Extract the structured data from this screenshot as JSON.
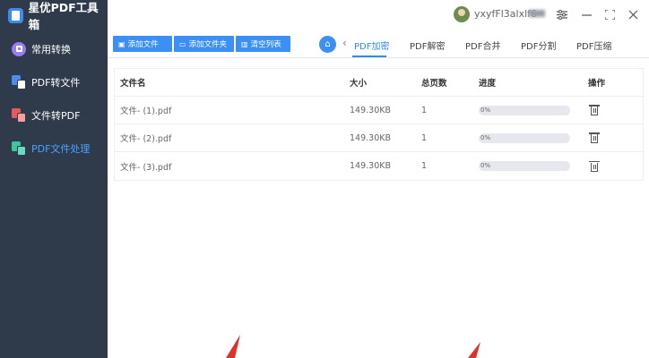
{
  "app": {
    "title": "星优PDF工具箱"
  },
  "sidebar": {
    "items": [
      {
        "label": "常用转换",
        "icon": "common-convert-icon"
      },
      {
        "label": "PDF转文件",
        "icon": "pdf-to-file-icon"
      },
      {
        "label": "文件转PDF",
        "icon": "file-to-pdf-icon"
      },
      {
        "label": "PDF文件处理",
        "icon": "pdf-process-icon",
        "active": true
      }
    ]
  },
  "titlebar": {
    "username": "yxyfFl3alxlf6",
    "settings_icon": "sliders-icon",
    "minimize_icon": "minimize-icon",
    "maximize_icon": "maximize-icon",
    "close_icon": "close-icon"
  },
  "toolbar": {
    "add_file": "添加文件",
    "add_folder": "添加文件夹",
    "clear_list": "清空列表"
  },
  "tabs": [
    "PDF加密",
    "PDF解密",
    "PDF合并",
    "PDF分割",
    "PDF压缩"
  ],
  "active_tab": "PDF加密",
  "table": {
    "headers": [
      "文件名",
      "大小",
      "总页数",
      "进度",
      "操作"
    ],
    "rows": [
      {
        "name": "文件- (1).pdf",
        "size": "149.30KB",
        "pages": "1",
        "progress": "0%",
        "progress_value": 0
      },
      {
        "name": "文件- (2).pdf",
        "size": "149.30KB",
        "pages": "1",
        "progress": "0%",
        "progress_value": 0
      },
      {
        "name": "文件- (3).pdf",
        "size": "149.30KB",
        "pages": "1",
        "progress": "0%",
        "progress_value": 0
      }
    ]
  },
  "colors": {
    "accent": "#3c8ff5",
    "sidebar": "#2f3a4a",
    "annotation": "#e0312a"
  }
}
